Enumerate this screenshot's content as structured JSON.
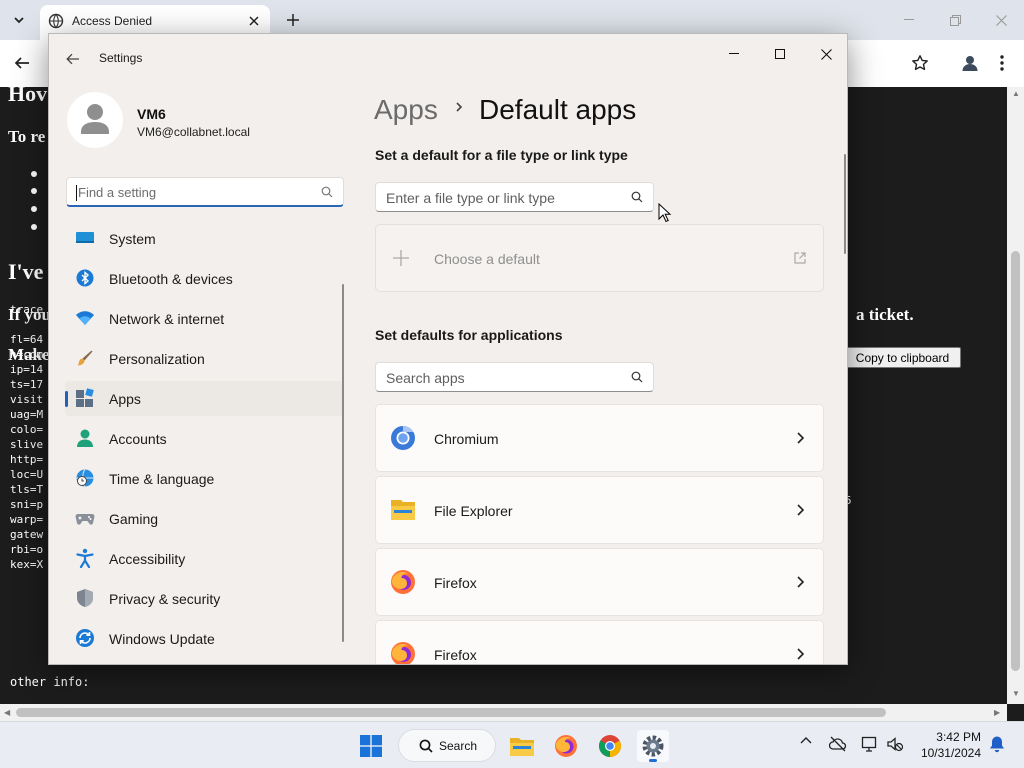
{
  "browser": {
    "tab_title": "Access Denied"
  },
  "page": {
    "heading_partial": "Hov",
    "line1": "To re",
    "heading2": "I've",
    "line_if": "If you",
    "line_if_tail": "a ticket.",
    "line_make": "Make",
    "copy_button": "Copy to clipboard",
    "mono_lines": [
      "trace",
      "fl=64",
      "h=com",
      "ip=14",
      "ts=17",
      "visit",
      "uag=M",
      "colo=",
      "slive",
      "http=",
      "loc=U",
      "tls=T",
      "sni=p",
      "warp=",
      "gatew",
      "rbi=o",
      "kex=X"
    ],
    "mono_side": "5",
    "other_info": "other info:"
  },
  "settings": {
    "app_title": "Settings",
    "user": {
      "name": "VM6",
      "email": "VM6@collabnet.local"
    },
    "search_placeholder": "Find a setting",
    "nav": [
      {
        "label": "System",
        "icon": "system-icon"
      },
      {
        "label": "Bluetooth & devices",
        "icon": "bluetooth-icon"
      },
      {
        "label": "Network & internet",
        "icon": "wifi-icon"
      },
      {
        "label": "Personalization",
        "icon": "brush-icon"
      },
      {
        "label": "Apps",
        "icon": "apps-icon",
        "selected": true
      },
      {
        "label": "Accounts",
        "icon": "accounts-icon"
      },
      {
        "label": "Time & language",
        "icon": "globe-clock-icon"
      },
      {
        "label": "Gaming",
        "icon": "gamepad-icon"
      },
      {
        "label": "Accessibility",
        "icon": "accessibility-icon"
      },
      {
        "label": "Privacy & security",
        "icon": "shield-icon"
      },
      {
        "label": "Windows Update",
        "icon": "update-icon"
      }
    ],
    "breadcrumb_parent": "Apps",
    "page_title": "Default apps",
    "section_filetype": "Set a default for a file type or link type",
    "filetype_placeholder": "Enter a file type or link type",
    "choose_default": "Choose a default",
    "section_apps": "Set defaults for applications",
    "apps_search_placeholder": "Search apps",
    "apps": [
      {
        "name": "Chromium",
        "icon": "chromium-icon"
      },
      {
        "name": "File Explorer",
        "icon": "file-explorer-icon"
      },
      {
        "name": "Firefox",
        "icon": "firefox-icon"
      },
      {
        "name": "Firefox",
        "icon": "firefox-icon"
      }
    ]
  },
  "taskbar": {
    "search_label": "Search",
    "time": "3:42 PM",
    "date": "10/31/2024"
  },
  "colors": {
    "accent": "#2160b8",
    "settings_bg": "#f3efec",
    "page_bg": "#1c1c1c"
  }
}
